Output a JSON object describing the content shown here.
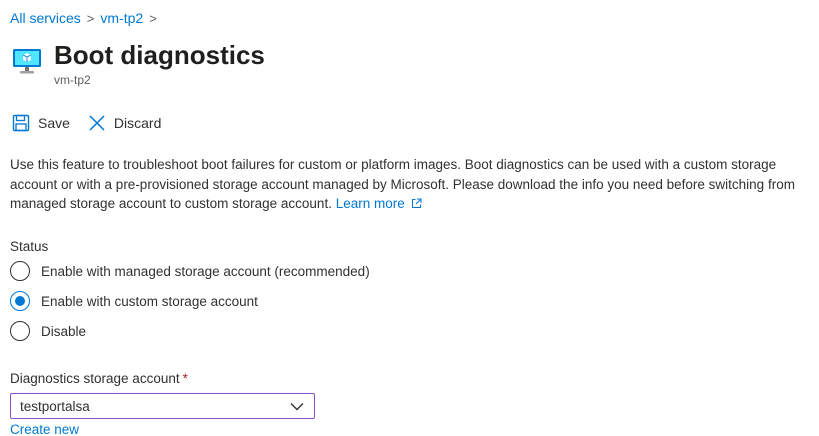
{
  "breadcrumb": {
    "items": [
      "All services",
      "vm-tp2"
    ],
    "separator": ">"
  },
  "header": {
    "title": "Boot diagnostics",
    "subtitle": "vm-tp2",
    "icon": "virtual-machine-icon"
  },
  "toolbar": {
    "save_label": "Save",
    "discard_label": "Discard"
  },
  "description": {
    "text": "Use this feature to troubleshoot boot failures for custom or platform images. Boot diagnostics can be used with a custom storage account or with a pre-provisioned storage account managed by Microsoft. Please download the info you need before switching from managed storage account to custom storage account.",
    "link_label": "Learn more",
    "link_icon": "external-link-icon"
  },
  "status": {
    "label": "Status",
    "options": [
      {
        "label": "Enable with managed storage account (recommended)",
        "selected": false
      },
      {
        "label": "Enable with custom storage account",
        "selected": true
      },
      {
        "label": "Disable",
        "selected": false
      }
    ]
  },
  "storage": {
    "label": "Diagnostics storage account",
    "required_mark": "*",
    "selected_value": "testportalsa",
    "create_new_label": "Create new"
  },
  "colors": {
    "link": "#0078d4",
    "required": "#a4262c",
    "select_border": "#8a50c8"
  }
}
